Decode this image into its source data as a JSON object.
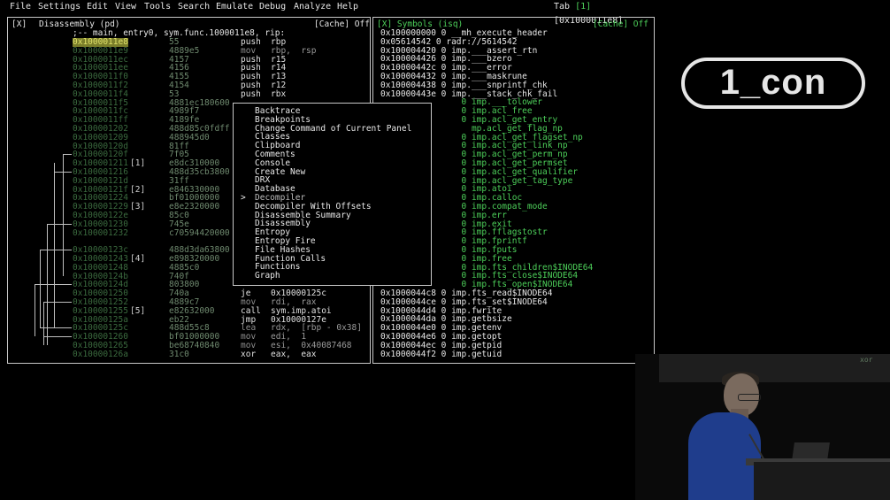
{
  "menubar": {
    "items": [
      "File",
      "Settings",
      "Edit",
      "View",
      "Tools",
      "Search",
      "Emulate",
      "Debug",
      "Analyze",
      "Help"
    ],
    "tab_label": "Tab",
    "tab_index": "[1]",
    "tab_addr": "[0x1000011e8]"
  },
  "disasm": {
    "close": "[X]",
    "title": "Disassembly (pd)",
    "cache": "[Cache] Off",
    "header": ";-- main, entry0, sym.func.1000011e8, rip:",
    "rows": [
      {
        "addr": "0x1000011e8",
        "hex": "55",
        "op": "push",
        "args": "rbp"
      },
      {
        "addr": "0x1000011e9",
        "hex": "4889e5",
        "op": "mov",
        "args": "rbp,  rsp"
      },
      {
        "addr": "0x1000011ec",
        "hex": "4157",
        "op": "push",
        "args": "r15"
      },
      {
        "addr": "0x1000011ee",
        "hex": "4156",
        "op": "push",
        "args": "r14"
      },
      {
        "addr": "0x1000011f0",
        "hex": "4155",
        "op": "push",
        "args": "r13"
      },
      {
        "addr": "0x1000011f2",
        "hex": "4154",
        "op": "push",
        "args": "r12"
      },
      {
        "addr": "0x1000011f4",
        "hex": "53",
        "op": "push",
        "args": "rbx"
      },
      {
        "addr": "0x1000011f5",
        "hex": "4881ec180600",
        "op": "",
        "args": ""
      },
      {
        "addr": "0x1000011fc",
        "hex": "4989f7",
        "op": "",
        "args": ""
      },
      {
        "addr": "0x1000011ff",
        "hex": "4189fe",
        "op": "",
        "args": ""
      },
      {
        "addr": "0x100001202",
        "hex": "488d85c0fdff",
        "op": "",
        "args": ""
      },
      {
        "addr": "0x100001209",
        "hex": "488945d0",
        "op": "",
        "args": ""
      },
      {
        "addr": "0x10000120d",
        "hex": "81ff",
        "op": "",
        "args": ""
      },
      {
        "addr": "0x10000120f",
        "hex": "7f05",
        "op": "",
        "args": ""
      },
      {
        "addr": "0x100001211",
        "hex": "e8dc310000",
        "op": "",
        "args": ""
      },
      {
        "addr": "0x100001216",
        "hex": "488d35cb3800",
        "op": "",
        "args": ""
      },
      {
        "addr": "0x10000121d",
        "hex": "31ff",
        "op": "",
        "args": ""
      },
      {
        "addr": "0x10000121f",
        "hex": "e846330000",
        "op": "",
        "args": ""
      },
      {
        "addr": "0x100001224",
        "hex": "bf01000000",
        "op": "",
        "args": ""
      },
      {
        "addr": "0x100001229",
        "hex": "e8e2320000",
        "op": "",
        "args": ""
      },
      {
        "addr": "0x10000122e",
        "hex": "85c0",
        "op": "",
        "args": ""
      },
      {
        "addr": "0x100001230",
        "hex": "745e",
        "op": "",
        "args": ""
      },
      {
        "addr": "0x100001232",
        "hex": "c70594420000",
        "op": "",
        "args": ""
      },
      {
        "addr": "",
        "hex": "",
        "op": "",
        "args": ""
      },
      {
        "addr": "0x10000123c",
        "hex": "488d3da63800",
        "op": "",
        "args": ""
      },
      {
        "addr": "0x100001243",
        "hex": "e898320000",
        "op": "",
        "args": ""
      },
      {
        "addr": "0x100001248",
        "hex": "4885c0",
        "op": "",
        "args": ""
      },
      {
        "addr": "0x10000124b",
        "hex": "740f",
        "op": "",
        "args": ""
      },
      {
        "addr": "0x10000124d",
        "hex": "803800",
        "op": "",
        "args": ""
      },
      {
        "addr": "0x100001250",
        "hex": "740a",
        "op": "je",
        "args": "0x10000125c"
      },
      {
        "addr": "0x100001252",
        "hex": "4889c7",
        "op": "mov",
        "args": "rdi,  rax"
      },
      {
        "addr": "0x100001255",
        "hex": "e82632000",
        "op": "call",
        "args": "sym.imp.atoi"
      },
      {
        "addr": "0x10000125a",
        "hex": "eb22",
        "op": "jmp",
        "args": "0x10000127e"
      },
      {
        "addr": "0x10000125c",
        "hex": "488d55c8",
        "op": "lea",
        "args": "rdx,  [rbp - 0x38]"
      },
      {
        "addr": "0x100001260",
        "hex": "bf01000000",
        "op": "mov",
        "args": "edi,  1"
      },
      {
        "addr": "0x100001265",
        "hex": "be68740840",
        "op": "mov",
        "args": "esi,  0x40087468"
      },
      {
        "addr": "0x10000126a",
        "hex": "31c0",
        "op": "xor",
        "args": "eax,  eax"
      }
    ],
    "labels": [
      {
        "row": 14,
        "text": "[1]"
      },
      {
        "row": 17,
        "text": "[2]"
      },
      {
        "row": 19,
        "text": "[3]"
      },
      {
        "row": 25,
        "text": "[4]"
      },
      {
        "row": 31,
        "text": "[5]"
      }
    ]
  },
  "symbols": {
    "close": "[X]",
    "title": "Symbols (isq)",
    "cache": "[Cache] Off",
    "rows": [
      {
        "text": "0x100000000 0 __mh_execute_header",
        "style": "a"
      },
      {
        "text": "0x05614542 0 radr://5614542",
        "style": "a"
      },
      {
        "text": "0x100004420 0 imp.___assert_rtn",
        "style": "a"
      },
      {
        "text": "0x100004426 0 imp.___bzero",
        "style": "a"
      },
      {
        "text": "0x10000442c 0 imp.___error",
        "style": "a"
      },
      {
        "text": "0x100004432 0 imp.___maskrune",
        "style": "a"
      },
      {
        "text": "0x100004438 0 imp.___snprintf_chk",
        "style": "a"
      },
      {
        "text": "0x10000443e 0 imp.___stack_chk_fail",
        "style": "a"
      },
      {
        "text": "                0 imp.___tolower",
        "style": "g"
      },
      {
        "text": "                0 imp.acl_free",
        "style": "g"
      },
      {
        "text": "                0 imp.acl_get_entry",
        "style": "g"
      },
      {
        "text": "                  mp.acl_get_flag_np",
        "style": "g"
      },
      {
        "text": "                0 imp.acl_get_flagset_np",
        "style": "g"
      },
      {
        "text": "                0 imp.acl_get_link_np",
        "style": "g"
      },
      {
        "text": "                0 imp.acl_get_perm_np",
        "style": "g"
      },
      {
        "text": "                0 imp.acl_get_permset",
        "style": "g"
      },
      {
        "text": "                0 imp.acl_get_qualifier",
        "style": "g"
      },
      {
        "text": "                0 imp.acl_get_tag_type",
        "style": "g"
      },
      {
        "text": "                0 imp.atoi",
        "style": "g"
      },
      {
        "text": "                0 imp.calloc",
        "style": "g"
      },
      {
        "text": "                0 imp.compat_mode",
        "style": "g"
      },
      {
        "text": "                0 imp.err",
        "style": "g"
      },
      {
        "text": "                0 imp.exit",
        "style": "g"
      },
      {
        "text": "                0 imp.fflagstostr",
        "style": "g"
      },
      {
        "text": "                0 imp.fprintf",
        "style": "g"
      },
      {
        "text": "                0 imp.fputs",
        "style": "g"
      },
      {
        "text": "                0 imp.free",
        "style": "g"
      },
      {
        "text": "                0 imp.fts_children$INODE64",
        "style": "g"
      },
      {
        "text": "                0 imp.fts_close$INODE64",
        "style": "g"
      },
      {
        "text": "                0 imp.fts_open$INODE64",
        "style": "g"
      },
      {
        "text": "0x1000044c8 0 imp.fts_read$INODE64",
        "style": "a"
      },
      {
        "text": "0x1000044ce 0 imp.fts_set$INODE64",
        "style": "a"
      },
      {
        "text": "0x1000044d4 0 imp.fwrite",
        "style": "a"
      },
      {
        "text": "0x1000044da 0 imp.getbsize",
        "style": "a"
      },
      {
        "text": "0x1000044e0 0 imp.getenv",
        "style": "a"
      },
      {
        "text": "0x1000044e6 0 imp.getopt",
        "style": "a"
      },
      {
        "text": "0x1000044ec 0 imp.getpid",
        "style": "a"
      },
      {
        "text": "0x1000044f2 0 imp.getuid",
        "style": "a"
      }
    ]
  },
  "menu": {
    "cursor": ">",
    "active_index": 10,
    "items": [
      "Backtrace",
      "Breakpoints",
      "Change Command of Current Panel",
      "Classes",
      "Clipboard",
      "Comments",
      "Console",
      "Create New",
      "DRX",
      "Database",
      "Decompiler",
      "Decompiler With Offsets",
      "Disassemble Summary",
      "Disassembly",
      "Entropy",
      "Entropy Fire",
      "File Hashes",
      "Function Calls",
      "Functions",
      "Graph"
    ]
  },
  "logo": {
    "text": "1_con"
  },
  "video": {
    "screen_text": "xor"
  }
}
